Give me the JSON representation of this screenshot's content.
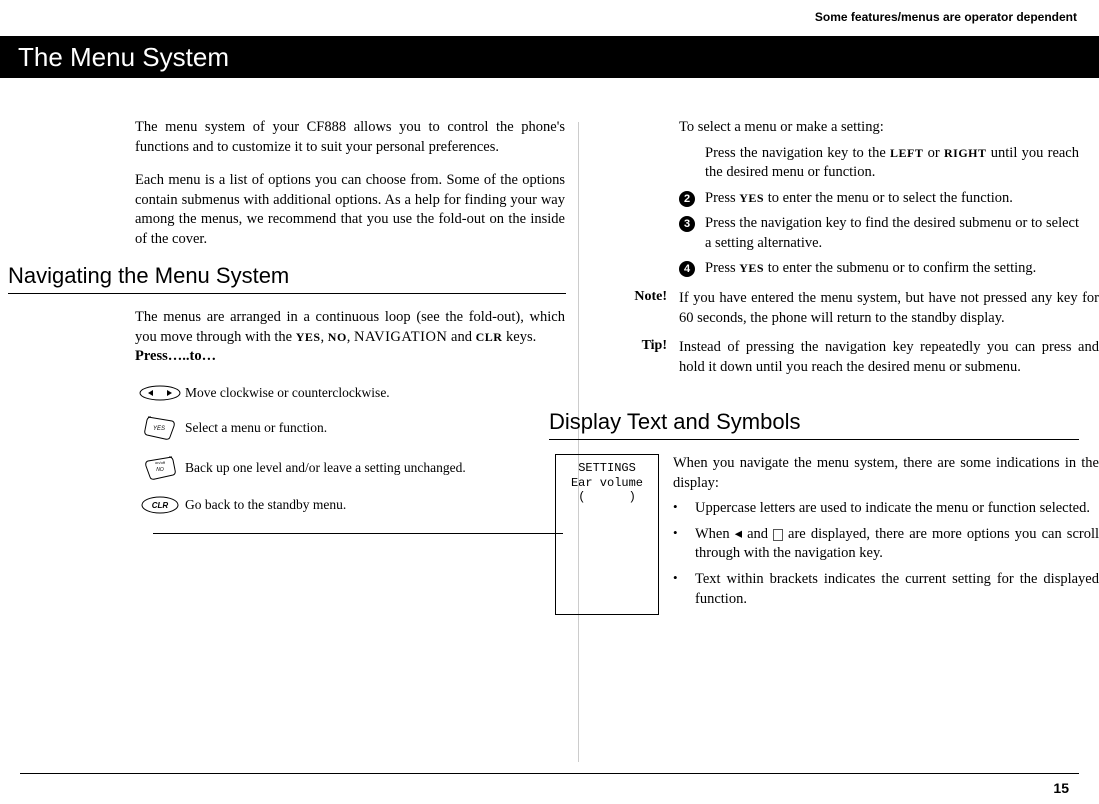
{
  "header_note": "Some features/menus are operator dependent",
  "title": "The Menu System",
  "left": {
    "intro_p1": "The menu system of your CF888 allows you to control the phone's functions and to customize it to suit your personal preferences.",
    "intro_p2": "Each menu is a list of options you can choose from. Some of the options contain submenus with additional options. As a help for finding your way among the menus, we recommend that you use the fold-out on the inside of the cover.",
    "section1_heading": "Navigating the Menu System",
    "nav_p1_a": "The menus are arranged in a continuous loop (see the fold-out), which you move through with the ",
    "nav_p1_yes": "YES",
    "nav_p1_b": ", ",
    "nav_p1_no": "NO",
    "nav_p1_c": ", ",
    "nav_p1_navigation": "NAVIGATION",
    "nav_p1_d": " and ",
    "nav_p1_clr": "CLR",
    "nav_p1_e": " keys.",
    "press_to": "Press…..to…",
    "keys": [
      "Move clockwise or counterclockwise.",
      "Select a menu or function.",
      "Back up one level and/or leave a setting unchanged.",
      "Go back to the standby menu."
    ]
  },
  "right": {
    "select_intro": "To select a menu or make a setting:",
    "step1_a": "Press the navigation key to the ",
    "step1_left": "LEFT",
    "step1_b": " or ",
    "step1_right": "RIGHT",
    "step1_c": " until you reach the desired menu or function.",
    "step2_a": "Press ",
    "step2_yes": "YES",
    "step2_b": " to enter the menu or to select the function.",
    "step3": "Press the navigation key to find the desired submenu or to select a setting alternative.",
    "step4_a": "Press ",
    "step4_yes": "YES",
    "step4_b": " to enter the submenu or to confirm the setting.",
    "note_label": "Note!",
    "note_body": "If you have entered the menu system, but have not pressed any key for 60 seconds, the phone will return to the standby display.",
    "tip_label": "Tip!",
    "tip_body": "Instead of pressing the navigation key repeatedly you can press and hold it down until you reach the desired menu or submenu.",
    "section2_heading": "Display Text and Symbols",
    "display_box": "SETTINGS\nEar volume\n(      )",
    "display_intro": "When you navigate the menu system, there are some indications in the display:",
    "bullets": {
      "b1": "Uppercase letters are used to indicate the menu or function selected.",
      "b2_a": "When ",
      "b2_b": " and ",
      "b2_c": " are displayed, there are more options you can scroll through with the navigation key.",
      "b3": "Text within brackets indicates the current setting for the displayed function."
    }
  },
  "page_number": "15"
}
